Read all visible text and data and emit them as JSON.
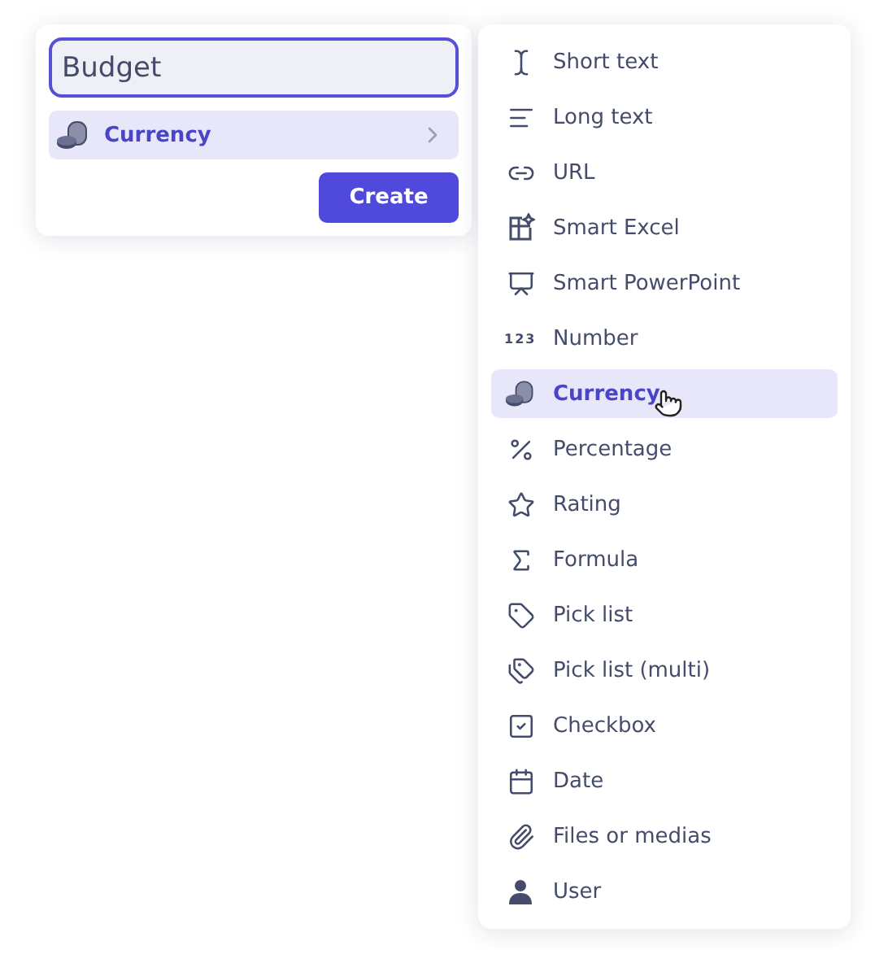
{
  "new_field": {
    "name_value": "Budget",
    "type_button": {
      "label": "Currency",
      "kind": "currency"
    },
    "create_button": "Create"
  },
  "type_menu": [
    {
      "label": "Short text",
      "kind": "short-text",
      "selected": false
    },
    {
      "label": "Long text",
      "kind": "long-text",
      "selected": false
    },
    {
      "label": "URL",
      "kind": "url",
      "selected": false
    },
    {
      "label": "Smart Excel",
      "kind": "smart-excel",
      "selected": false
    },
    {
      "label": "Smart PowerPoint",
      "kind": "smart-powerpoint",
      "selected": false
    },
    {
      "label": "Number",
      "kind": "number",
      "glyph": "123",
      "selected": false
    },
    {
      "label": "Currency",
      "kind": "currency",
      "selected": true
    },
    {
      "label": "Percentage",
      "kind": "percentage",
      "selected": false
    },
    {
      "label": "Rating",
      "kind": "rating",
      "selected": false
    },
    {
      "label": "Formula",
      "kind": "formula",
      "selected": false
    },
    {
      "label": "Pick list",
      "kind": "pick-list",
      "selected": false
    },
    {
      "label": "Pick list (multi)",
      "kind": "pick-list-multi",
      "selected": false
    },
    {
      "label": "Checkbox",
      "kind": "checkbox",
      "selected": false
    },
    {
      "label": "Date",
      "kind": "date",
      "selected": false
    },
    {
      "label": "Files or medias",
      "kind": "files",
      "selected": false
    },
    {
      "label": "User",
      "kind": "user",
      "selected": false
    }
  ]
}
